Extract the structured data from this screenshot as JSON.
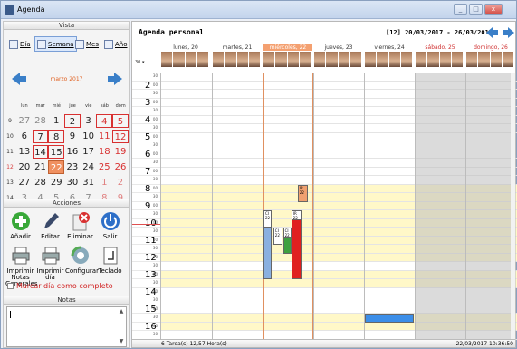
{
  "window": {
    "title": "Agenda"
  },
  "vista": {
    "header": "Vista",
    "buttons": [
      {
        "label": "Día",
        "active": false
      },
      {
        "label": "Semana",
        "active": true
      },
      {
        "label": "Mes",
        "active": false
      },
      {
        "label": "Año",
        "active": false
      }
    ]
  },
  "calendar": {
    "month_title": "marzo 2017",
    "dow": [
      "lun",
      "mar",
      "mié",
      "jue",
      "vie",
      "sáb",
      "dom"
    ],
    "weeks": [
      {
        "no": "9",
        "days": [
          [
            "27",
            "other"
          ],
          [
            "28",
            "other"
          ],
          [
            "1",
            ""
          ],
          [
            "2",
            "sel"
          ],
          [
            "3",
            ""
          ],
          [
            "4",
            "weekend sel"
          ],
          [
            "5",
            "weekend sel"
          ]
        ]
      },
      {
        "no": "10",
        "days": [
          [
            "6",
            ""
          ],
          [
            "7",
            "sel"
          ],
          [
            "8",
            "sel"
          ],
          [
            "9",
            ""
          ],
          [
            "10",
            ""
          ],
          [
            "11",
            "weekend"
          ],
          [
            "12",
            "weekend sel"
          ]
        ]
      },
      {
        "no": "11",
        "days": [
          [
            "13",
            ""
          ],
          [
            "14",
            "sel"
          ],
          [
            "15",
            "sel"
          ],
          [
            "16",
            ""
          ],
          [
            "17",
            ""
          ],
          [
            "18",
            "weekend"
          ],
          [
            "19",
            "weekend"
          ]
        ]
      },
      {
        "no": "12",
        "days": [
          [
            "20",
            ""
          ],
          [
            "21",
            ""
          ],
          [
            "22",
            "today"
          ],
          [
            "23",
            ""
          ],
          [
            "24",
            ""
          ],
          [
            "25",
            "weekend"
          ],
          [
            "26",
            "weekend"
          ]
        ]
      },
      {
        "no": "13",
        "days": [
          [
            "27",
            ""
          ],
          [
            "28",
            ""
          ],
          [
            "29",
            ""
          ],
          [
            "30",
            ""
          ],
          [
            "31",
            ""
          ],
          [
            "1",
            "other weekend"
          ],
          [
            "2",
            "other weekend"
          ]
        ]
      },
      {
        "no": "14",
        "days": [
          [
            "3",
            "other"
          ],
          [
            "4",
            "other"
          ],
          [
            "5",
            "other"
          ],
          [
            "6",
            "other"
          ],
          [
            "7",
            "other"
          ],
          [
            "8",
            "other weekend"
          ],
          [
            "9",
            "other weekend"
          ]
        ]
      }
    ],
    "red_week_no": "12"
  },
  "acciones": {
    "header": "Acciones",
    "buttons": [
      {
        "label": "Añadir",
        "icon": "add-icon"
      },
      {
        "label": "Editar",
        "icon": "pencil-icon"
      },
      {
        "label": "Eliminar",
        "icon": "delete-icon"
      },
      {
        "label": "Salir",
        "icon": "power-icon"
      },
      {
        "label": "Imprimir\nNotas\nGenerales",
        "icon": "printer-icon"
      },
      {
        "label": "Imprimir\ndía",
        "icon": "printer-icon"
      },
      {
        "label": "Configurar",
        "icon": "gear-icon"
      },
      {
        "label": "Teclado",
        "icon": "keyboard-icon"
      }
    ],
    "complete_label": "Marcar día como completo"
  },
  "notas": {
    "header": "Notas",
    "value": ""
  },
  "agenda": {
    "title": "Agenda personal",
    "range": "[12] 20/03/2017 - 26/03/2017",
    "zoom": "30",
    "days": [
      {
        "label": "lunes, 20",
        "kind": ""
      },
      {
        "label": "martes, 21",
        "kind": ""
      },
      {
        "label": "miércoles, 22",
        "kind": "today"
      },
      {
        "label": "jueves, 23",
        "kind": ""
      },
      {
        "label": "viernes, 24",
        "kind": ""
      },
      {
        "label": "sábado, 25",
        "kind": "weekend"
      },
      {
        "label": "domingo, 26",
        "kind": "weekend"
      }
    ],
    "hours": [
      "2",
      "3",
      "4",
      "5",
      "6",
      "7",
      "8",
      "9",
      "10",
      "11",
      "12",
      "13",
      "14",
      "15",
      "16"
    ],
    "events": [
      {
        "text": "IR 22",
        "color": "#f0a070",
        "day": 2,
        "sub": 0.7,
        "w": 0.2,
        "start": 8.0,
        "end": 9.0
      },
      {
        "text": "CI 22",
        "color": "#ffffff",
        "day": 2,
        "sub": 0.0,
        "w": 0.17,
        "start": 9.5,
        "end": 10.5
      },
      {
        "text": "IR 22",
        "color": "#ffffff",
        "day": 2,
        "sub": 0.57,
        "w": 0.2,
        "start": 9.5,
        "end": 10.5
      },
      {
        "text": "CI 22",
        "color": "#ffffff",
        "day": 2,
        "sub": 0.2,
        "w": 0.18,
        "start": 10.5,
        "end": 11.5
      },
      {
        "text": "CI 22",
        "color": "#ffffff",
        "day": 2,
        "sub": 0.4,
        "w": 0.18,
        "start": 10.5,
        "end": 11.5
      },
      {
        "text": "PI 22",
        "color": "#ffffff",
        "day": 2,
        "sub": 0.0,
        "w": 0.17,
        "start": 11.0,
        "end": 12.0
      },
      {
        "text": "",
        "color": "#8ab0e0",
        "day": 2,
        "sub": 0.0,
        "w": 0.17,
        "start": 10.5,
        "end": 13.5
      },
      {
        "text": "",
        "color": "#40a040",
        "day": 2,
        "sub": 0.4,
        "w": 0.18,
        "start": 11.0,
        "end": 12.0
      },
      {
        "text": "",
        "color": "#e02020",
        "day": 2,
        "sub": 0.57,
        "w": 0.2,
        "start": 10.0,
        "end": 13.5
      },
      {
        "text": "",
        "color": "#3c8ee8",
        "day": 4,
        "sub": 0.0,
        "w": 1.0,
        "start": 15.5,
        "end": 16.0
      }
    ],
    "shading": [
      {
        "start": 8.0,
        "end": 12.5,
        "color": "#fff8c8"
      },
      {
        "start": 13.0,
        "end": 14.0,
        "color": "#fff8c8"
      },
      {
        "start": 15.5,
        "end": 16.5,
        "color": "#fff8c8"
      }
    ],
    "tasks": "6 Tarea(s) 12,57 Hora(s)",
    "datetime": "22/03/2017  10:36:50"
  }
}
